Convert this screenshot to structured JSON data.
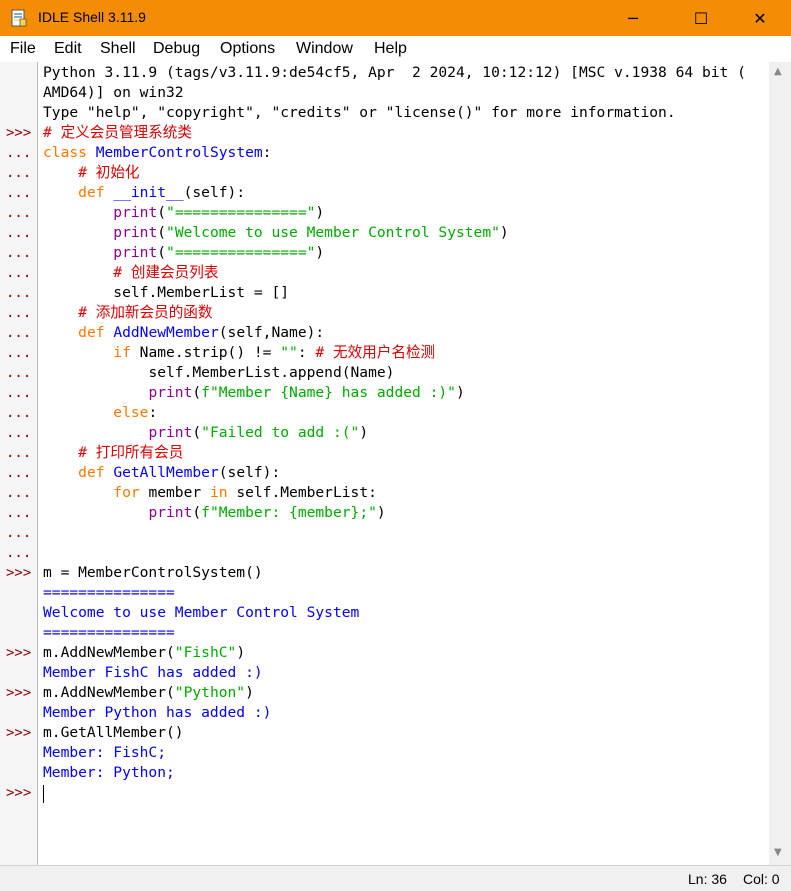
{
  "window": {
    "title": "IDLE Shell 3.11.9",
    "minimize_glyph": "─",
    "maximize_glyph": "☐",
    "close_glyph": "✕"
  },
  "menu": [
    "File",
    "Edit",
    "Shell",
    "Debug",
    "Options",
    "Window",
    "Help"
  ],
  "prompts": {
    "primary": ">>>",
    "continuation": "..."
  },
  "banner": {
    "line1": "Python 3.11.9 (tags/v3.11.9:de54cf5, Apr  2 2024, 10:12:12) [MSC v.1938 64 bit (",
    "line2": "AMD64)] on win32",
    "line3": "Type \"help\", \"copyright\", \"credits\" or \"license()\" for more information."
  },
  "code": {
    "c1": "# 定义会员管理系统类",
    "c2_kw": "class",
    "c2_name": "MemberControlSystem",
    "c3": "# 初始化",
    "c4_kw": "def",
    "c4_name": "__init__",
    "c4_rest": "(self):",
    "p_print": "print",
    "s_eq": "\"===============\"",
    "s_welcome": "\"Welcome to use Member Control System\"",
    "c8": "# 创建会员列表",
    "c9": "self.MemberList = []",
    "c10": "# 添加新会员的函数",
    "c11_name": "AddNewMember",
    "c11_rest": "(self,Name):",
    "c12_if": "if",
    "c12_mid": "Name.strip() != ",
    "s_empty": "\"\"",
    "c12_colon": ": ",
    "c12_cmt": "# 无效用户名检测",
    "c13": "self.MemberList.append(Name)",
    "s_added": "f\"Member {Name} has added :)\"",
    "c15_else": "else",
    "s_failed": "\"Failed to add :(\"",
    "c17": "# 打印所有会员",
    "c18_name": "GetAllMember",
    "c18_rest": "(self):",
    "c19_for": "for",
    "c19_mid": " member ",
    "c19_in": "in",
    "c19_rest": " self.MemberList:",
    "s_member": "f\"Member: {member};\""
  },
  "session": {
    "cmd1": "m = MemberControlSystem()",
    "out1a": "===============",
    "out1b": "Welcome to use Member Control System",
    "out1c": "===============",
    "cmd2_pre": "m.AddNewMember(",
    "cmd2_str": "\"FishC\"",
    "out2": "Member FishC has added :)",
    "cmd3_str": "\"Python\"",
    "out3": "Member Python has added :)",
    "cmd4": "m.GetAllMember()",
    "out4a": "Member: FishC;",
    "out4b": "Member: Python;"
  },
  "status": {
    "line": "Ln: 36",
    "col": "Col: 0"
  },
  "colors": {
    "titlebar": "#f48c06",
    "keyword": "#ff7700",
    "definition": "#0000ff",
    "builtin": "#900090",
    "string": "#00aa00",
    "comment": "#dd0000",
    "stdout": "#0000ff",
    "prompt": "#8b0000"
  }
}
